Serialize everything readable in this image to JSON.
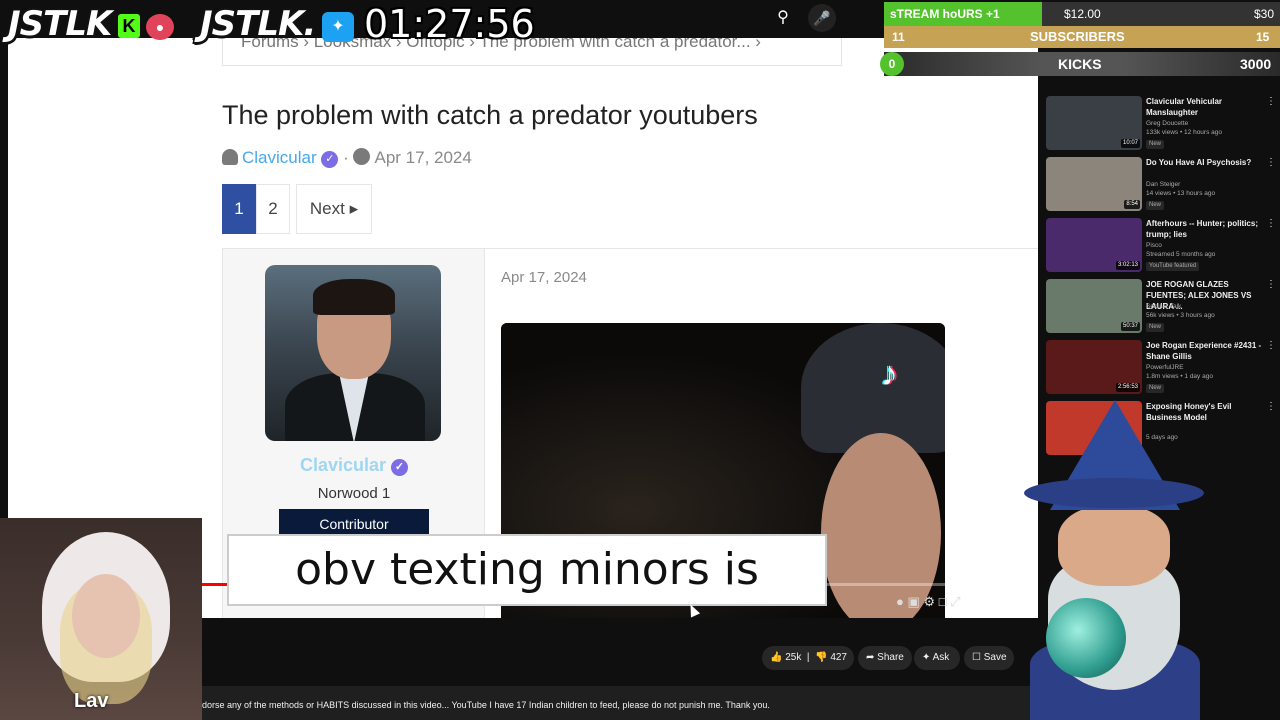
{
  "overlay": {
    "logo1": "JSTLK",
    "logo1_badge": "K",
    "logo2": "JSTLK.",
    "timer": "01:27:56",
    "stream_goal": {
      "label": "sTREAM hoURS +1",
      "current": "$12.00",
      "goal": "$30",
      "progress": 0.4
    },
    "subs_goal": {
      "count": "11",
      "label": "SUBSCRIBERS",
      "goal": "15"
    },
    "kicks_goal": {
      "count": "0",
      "label": "KICKS",
      "goal": "3000"
    },
    "cam_name": "Lav"
  },
  "forum": {
    "breadcrumb": "Forums › Looksmax › Offtopic › The problem with catch a predator... ›",
    "title": "The problem with catch a predator youtubers",
    "author": "Clavicular",
    "date": "Apr 17, 2024",
    "pages": [
      "1",
      "2"
    ],
    "next_label": "Next ▸",
    "user": {
      "name": "Clavicular",
      "location": "Norwood 1",
      "badge": "Contributor"
    },
    "post_date": "Apr 17, 2024"
  },
  "video": {
    "subtitle": "obv texting minors is wrong",
    "progress": 0.32
  },
  "actions": {
    "likes": "25k",
    "dislikes": "427",
    "share": "Share",
    "ask": "Ask",
    "save": "Save"
  },
  "description": "dorse any of the methods or HABITS discussed in this video... YouTube I have 17 Indian children to feed, please do not punish me. Thank you.",
  "recommendations": [
    {
      "title": "Clavicular Vehicular Manslaughter",
      "channel": "Greg Doucette",
      "meta": "133k views • 12 hours ago",
      "badge": "New",
      "duration": "10:07",
      "thumb_color": "#3a3f46"
    },
    {
      "title": "Do You Have AI Psychosis?",
      "channel": "Dan Steiger",
      "meta": "14 views • 13 hours ago",
      "badge": "New",
      "duration": "8:54",
      "thumb_color": "#8b857c"
    },
    {
      "title": "Afterhours -- Hunter; politics; trump; lies",
      "channel": "Pisco",
      "meta": "Streamed 5 months ago",
      "badge": "YouTube featured",
      "duration": "3:02:13",
      "thumb_color": "#4a2a6a"
    },
    {
      "title": "JOE ROGAN GLAZES FUENTES; ALEX JONES VS LAURA ...",
      "channel": "Secular Talk",
      "meta": "56k views • 3 hours ago",
      "badge": "New",
      "duration": "50:37",
      "thumb_color": "#6a7a6a"
    },
    {
      "title": "Joe Rogan Experience #2431 - Shane Gillis",
      "channel": "PowerfulJRE",
      "meta": "1.8m views • 1 day ago",
      "badge": "New",
      "duration": "2:56:53",
      "thumb_color": "#5a1a1a"
    },
    {
      "title": "Exposing Honey's Evil Business Model",
      "channel": "",
      "meta": "5 days ago",
      "badge": "",
      "duration": "",
      "thumb_color": "#c0392b"
    }
  ]
}
